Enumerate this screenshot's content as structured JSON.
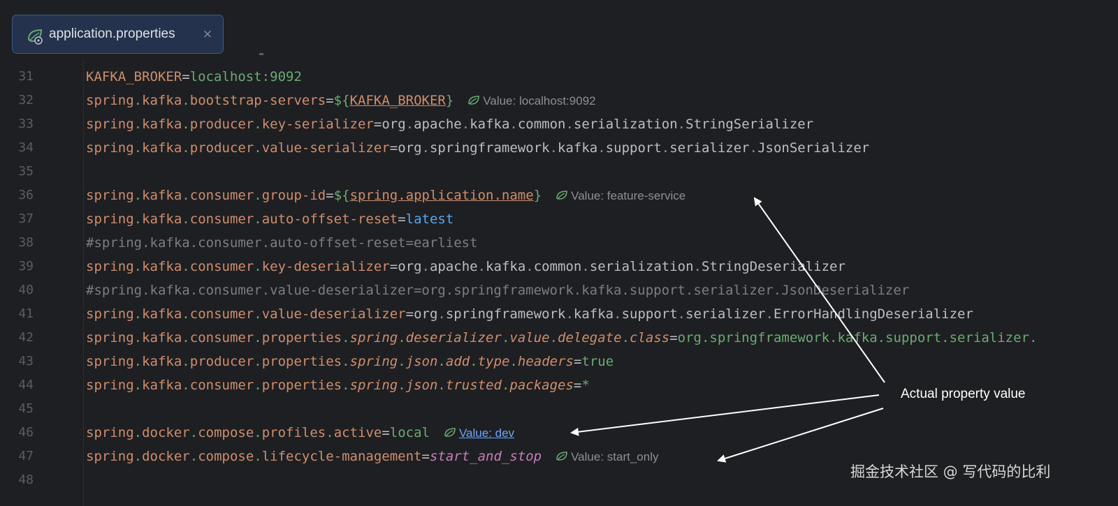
{
  "tab": {
    "filename": "application.properties",
    "close_glyph": "×",
    "icon": "spring-leaf-icon"
  },
  "lines": [
    {
      "n": "31",
      "segs": [
        [
          "k",
          "KAFKA_BROKER"
        ],
        [
          "eq",
          "="
        ],
        [
          "v",
          "localhost:9092"
        ]
      ]
    },
    {
      "n": "32",
      "segs": [
        [
          "k",
          "spring"
        ],
        [
          "dt",
          "."
        ],
        [
          "k",
          "kafka"
        ],
        [
          "dt",
          "."
        ],
        [
          "k",
          "bootstrap-servers"
        ],
        [
          "eq",
          "="
        ],
        [
          "br",
          "${"
        ],
        [
          "ref",
          "KAFKA_BROKER"
        ],
        [
          "br",
          "}"
        ]
      ],
      "hint": "Value: localhost:9092"
    },
    {
      "n": "33",
      "segs": [
        [
          "k",
          "spring"
        ],
        [
          "dt",
          "."
        ],
        [
          "k",
          "kafka"
        ],
        [
          "dt",
          "."
        ],
        [
          "k",
          "producer"
        ],
        [
          "dt",
          "."
        ],
        [
          "k",
          "key-serializer"
        ],
        [
          "eq",
          "="
        ],
        [
          "vw",
          "org"
        ],
        [
          "dt",
          "."
        ],
        [
          "vw",
          "apache"
        ],
        [
          "dt",
          "."
        ],
        [
          "vw",
          "kafka"
        ],
        [
          "dt",
          "."
        ],
        [
          "vw",
          "common"
        ],
        [
          "dt",
          "."
        ],
        [
          "vw",
          "serialization"
        ],
        [
          "dt",
          "."
        ],
        [
          "vw",
          "StringSerializer"
        ]
      ]
    },
    {
      "n": "34",
      "segs": [
        [
          "k",
          "spring"
        ],
        [
          "dt",
          "."
        ],
        [
          "k",
          "kafka"
        ],
        [
          "dt",
          "."
        ],
        [
          "k",
          "producer"
        ],
        [
          "dt",
          "."
        ],
        [
          "k",
          "value-serializer"
        ],
        [
          "eq",
          "="
        ],
        [
          "vw",
          "org"
        ],
        [
          "dt",
          "."
        ],
        [
          "vw",
          "springframework"
        ],
        [
          "dt",
          "."
        ],
        [
          "vw",
          "kafka"
        ],
        [
          "dt",
          "."
        ],
        [
          "vw",
          "support"
        ],
        [
          "dt",
          "."
        ],
        [
          "vw",
          "serializer"
        ],
        [
          "dt",
          "."
        ],
        [
          "vw",
          "JsonSerializer"
        ]
      ]
    },
    {
      "n": "35",
      "segs": []
    },
    {
      "n": "36",
      "segs": [
        [
          "k",
          "spring"
        ],
        [
          "dt",
          "."
        ],
        [
          "k",
          "kafka"
        ],
        [
          "dt",
          "."
        ],
        [
          "k",
          "consumer"
        ],
        [
          "dt",
          "."
        ],
        [
          "k",
          "group-id"
        ],
        [
          "eq",
          "="
        ],
        [
          "br",
          "${"
        ],
        [
          "ref",
          "spring.application.name"
        ],
        [
          "br",
          "}"
        ]
      ],
      "hint": "Value: feature-service"
    },
    {
      "n": "37",
      "segs": [
        [
          "k",
          "spring"
        ],
        [
          "dt",
          "."
        ],
        [
          "k",
          "kafka"
        ],
        [
          "dt",
          "."
        ],
        [
          "k",
          "consumer"
        ],
        [
          "dt",
          "."
        ],
        [
          "k",
          "auto-offset-reset"
        ],
        [
          "eq",
          "="
        ],
        [
          "blue",
          "latest"
        ]
      ]
    },
    {
      "n": "38",
      "segs": [
        [
          "cm",
          "#spring.kafka.consumer.auto-offset-reset=earliest"
        ]
      ]
    },
    {
      "n": "39",
      "segs": [
        [
          "k",
          "spring"
        ],
        [
          "dt",
          "."
        ],
        [
          "k",
          "kafka"
        ],
        [
          "dt",
          "."
        ],
        [
          "k",
          "consumer"
        ],
        [
          "dt",
          "."
        ],
        [
          "k",
          "key-deserializer"
        ],
        [
          "eq",
          "="
        ],
        [
          "vw",
          "org"
        ],
        [
          "dt",
          "."
        ],
        [
          "vw",
          "apache"
        ],
        [
          "dt",
          "."
        ],
        [
          "vw",
          "kafka"
        ],
        [
          "dt",
          "."
        ],
        [
          "vw",
          "common"
        ],
        [
          "dt",
          "."
        ],
        [
          "vw",
          "serialization"
        ],
        [
          "dt",
          "."
        ],
        [
          "vw",
          "StringDeserializer"
        ]
      ]
    },
    {
      "n": "40",
      "segs": [
        [
          "cm",
          "#spring.kafka.consumer.value-deserializer=org.springframework.kafka.support.serializer.JsonDeserializer"
        ]
      ]
    },
    {
      "n": "41",
      "segs": [
        [
          "k",
          "spring"
        ],
        [
          "dt",
          "."
        ],
        [
          "k",
          "kafka"
        ],
        [
          "dt",
          "."
        ],
        [
          "k",
          "consumer"
        ],
        [
          "dt",
          "."
        ],
        [
          "k",
          "value-deserializer"
        ],
        [
          "eq",
          "="
        ],
        [
          "vw",
          "org"
        ],
        [
          "dt",
          "."
        ],
        [
          "vw",
          "springframework"
        ],
        [
          "dt",
          "."
        ],
        [
          "vw",
          "kafka"
        ],
        [
          "dt",
          "."
        ],
        [
          "vw",
          "support"
        ],
        [
          "dt",
          "."
        ],
        [
          "vw",
          "serializer"
        ],
        [
          "dt",
          "."
        ],
        [
          "vw",
          "ErrorHandlingDeserializer"
        ]
      ]
    },
    {
      "n": "42",
      "segs": [
        [
          "k",
          "spring"
        ],
        [
          "dt",
          "."
        ],
        [
          "k",
          "kafka"
        ],
        [
          "dt",
          "."
        ],
        [
          "k",
          "consumer"
        ],
        [
          "dt",
          "."
        ],
        [
          "k",
          "properties"
        ],
        [
          "dt",
          "."
        ],
        [
          "ki",
          "spring"
        ],
        [
          "dt",
          "."
        ],
        [
          "ki",
          "deserializer"
        ],
        [
          "dt",
          "."
        ],
        [
          "ki",
          "value"
        ],
        [
          "dt",
          "."
        ],
        [
          "ki",
          "delegate"
        ],
        [
          "dt",
          "."
        ],
        [
          "ki",
          "class"
        ],
        [
          "eq",
          "="
        ],
        [
          "v",
          "org.springframework.kafka.support.serializer."
        ]
      ]
    },
    {
      "n": "43",
      "segs": [
        [
          "k",
          "spring"
        ],
        [
          "dt",
          "."
        ],
        [
          "k",
          "kafka"
        ],
        [
          "dt",
          "."
        ],
        [
          "k",
          "producer"
        ],
        [
          "dt",
          "."
        ],
        [
          "k",
          "properties"
        ],
        [
          "dt",
          "."
        ],
        [
          "ki",
          "spring"
        ],
        [
          "dt",
          "."
        ],
        [
          "ki",
          "json"
        ],
        [
          "dt",
          "."
        ],
        [
          "ki",
          "add"
        ],
        [
          "dt",
          "."
        ],
        [
          "ki",
          "type"
        ],
        [
          "dt",
          "."
        ],
        [
          "ki",
          "headers"
        ],
        [
          "eq",
          "="
        ],
        [
          "v",
          "true"
        ]
      ]
    },
    {
      "n": "44",
      "segs": [
        [
          "k",
          "spring"
        ],
        [
          "dt",
          "."
        ],
        [
          "k",
          "kafka"
        ],
        [
          "dt",
          "."
        ],
        [
          "k",
          "consumer"
        ],
        [
          "dt",
          "."
        ],
        [
          "k",
          "properties"
        ],
        [
          "dt",
          "."
        ],
        [
          "ki",
          "spring"
        ],
        [
          "dt",
          "."
        ],
        [
          "ki",
          "json"
        ],
        [
          "dt",
          "."
        ],
        [
          "ki",
          "trusted"
        ],
        [
          "dt",
          "."
        ],
        [
          "ki",
          "packages"
        ],
        [
          "eq",
          "="
        ],
        [
          "v",
          "*"
        ]
      ]
    },
    {
      "n": "45",
      "segs": []
    },
    {
      "n": "46",
      "segs": [
        [
          "k",
          "spring"
        ],
        [
          "dt",
          "."
        ],
        [
          "k",
          "docker"
        ],
        [
          "dt",
          "."
        ],
        [
          "k",
          "compose"
        ],
        [
          "dt",
          "."
        ],
        [
          "k",
          "profiles"
        ],
        [
          "dt",
          "."
        ],
        [
          "k",
          "active"
        ],
        [
          "eq",
          "="
        ],
        [
          "v",
          "local"
        ]
      ],
      "hint": "Value: dev",
      "hint_link": true
    },
    {
      "n": "47",
      "segs": [
        [
          "k",
          "spring"
        ],
        [
          "dt",
          "."
        ],
        [
          "k",
          "docker"
        ],
        [
          "dt",
          "."
        ],
        [
          "k",
          "compose"
        ],
        [
          "dt",
          "."
        ],
        [
          "k",
          "lifecycle-management"
        ],
        [
          "eq",
          "="
        ],
        [
          "purple",
          "start_and_stop"
        ]
      ],
      "hint": "Value: start_only"
    },
    {
      "n": "48",
      "segs": []
    }
  ],
  "annotation": {
    "label": "Actual property value"
  },
  "watermark": "掘金技术社区 @ 写代码的比利",
  "colors": {
    "background": "#1e1f22",
    "key": "#cf8e6d",
    "string_value": "#6aab73",
    "keyword_value": "#56a8f5",
    "enum_value": "#c77dbb",
    "comment": "#7a7e85",
    "hint": "#8c8f94",
    "tab_border": "#3d5a87"
  }
}
